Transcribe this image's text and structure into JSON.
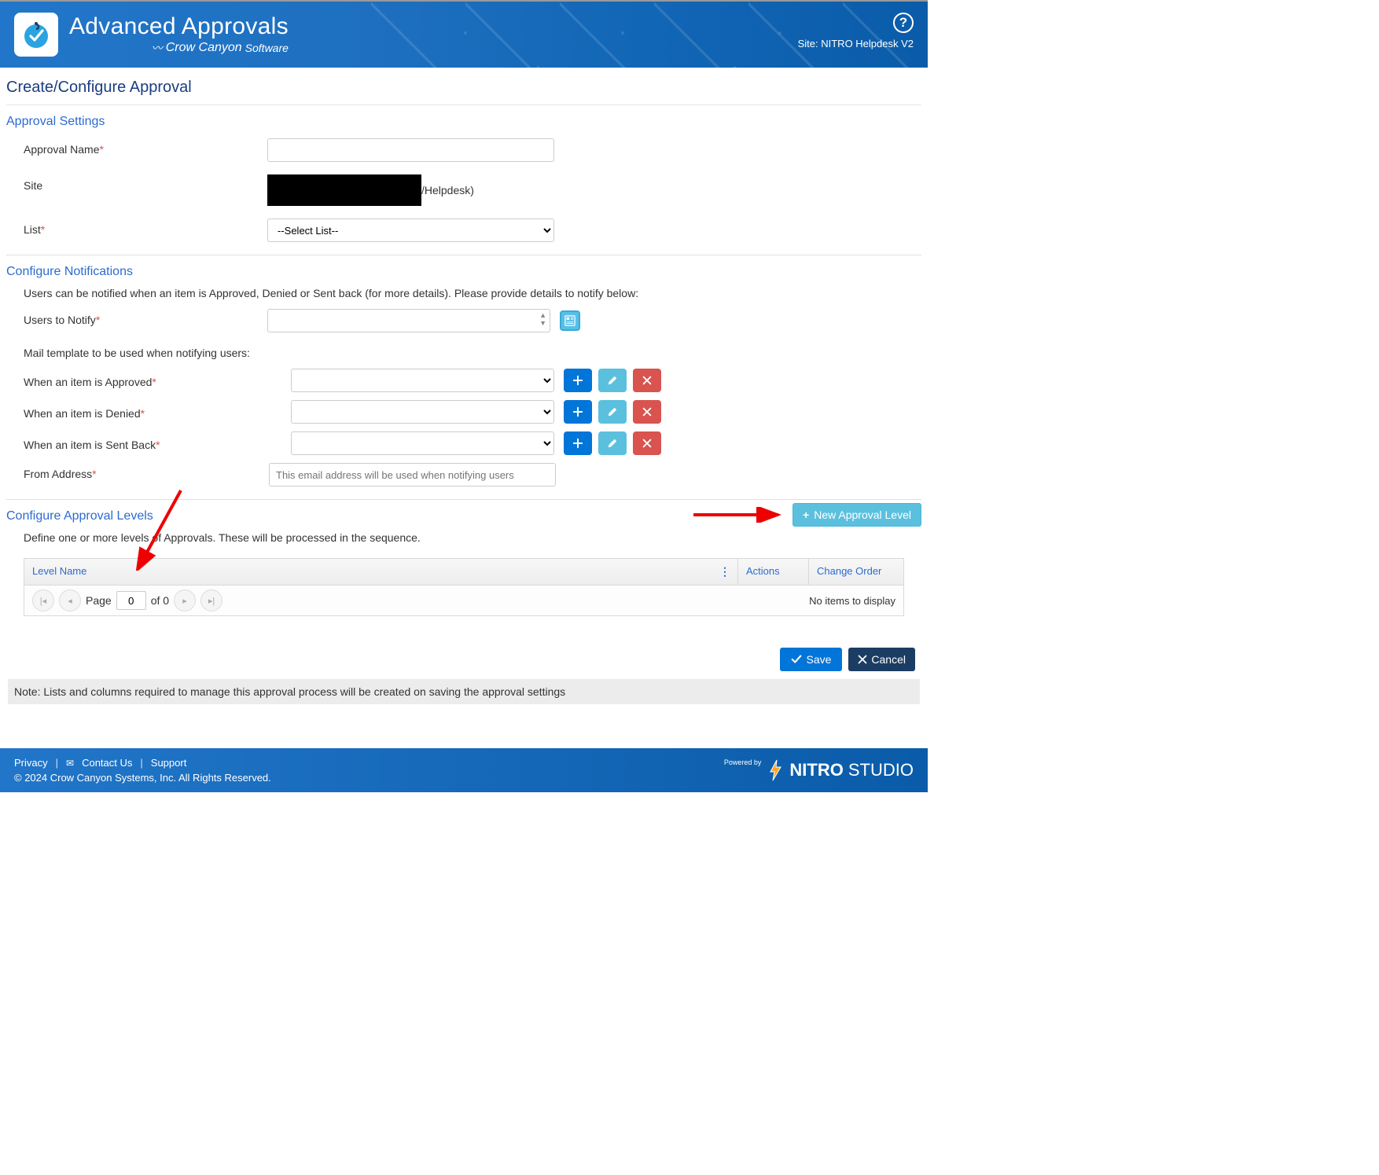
{
  "header": {
    "app_title": "Advanced Approvals",
    "brand_left": "Crow Canyon",
    "brand_right": "Software",
    "help_symbol": "?",
    "site_label": "Site:",
    "site_value": "NITRO Helpdesk V2"
  },
  "page": {
    "title": "Create/Configure Approval"
  },
  "settings": {
    "section": "Approval Settings",
    "name_label": "Approval Name",
    "name_value": "",
    "site_label": "Site",
    "site_tail": "/Helpdesk)",
    "list_label": "List",
    "list_selected": "--Select List--"
  },
  "notify": {
    "section": "Configure Notifications",
    "hint": "Users can be notified when an item is Approved, Denied or Sent back (for more details). Please provide details to notify below:",
    "users_label": "Users to Notify",
    "tmpl_header": "Mail template to be used when notifying users:",
    "approved_label": "When an item is Approved",
    "denied_label": "When an item is Denied",
    "sentback_label": "When an item is Sent Back",
    "from_label": "From Address",
    "from_placeholder": "This email address will be used when notifying users"
  },
  "levels": {
    "section": "Configure Approval Levels",
    "new_btn": "New Approval Level",
    "hint": "Define one or more levels of Approvals. These will be processed in the sequence.",
    "col_name": "Level Name",
    "col_actions": "Actions",
    "col_order": "Change Order",
    "page_label": "Page",
    "page_value": "0",
    "page_of": "of 0",
    "empty": "No items to display"
  },
  "actions": {
    "save": "Save",
    "cancel": "Cancel"
  },
  "note": "Note: Lists and columns required to manage this approval process will be created on saving the approval settings",
  "footer": {
    "privacy": "Privacy",
    "contact": "Contact Us",
    "support": "Support",
    "copyright": "© 2024 Crow Canyon Systems, Inc. All Rights Reserved.",
    "powered": "Powered by",
    "brand1": "NITRO",
    "brand2": "STUDIO"
  }
}
